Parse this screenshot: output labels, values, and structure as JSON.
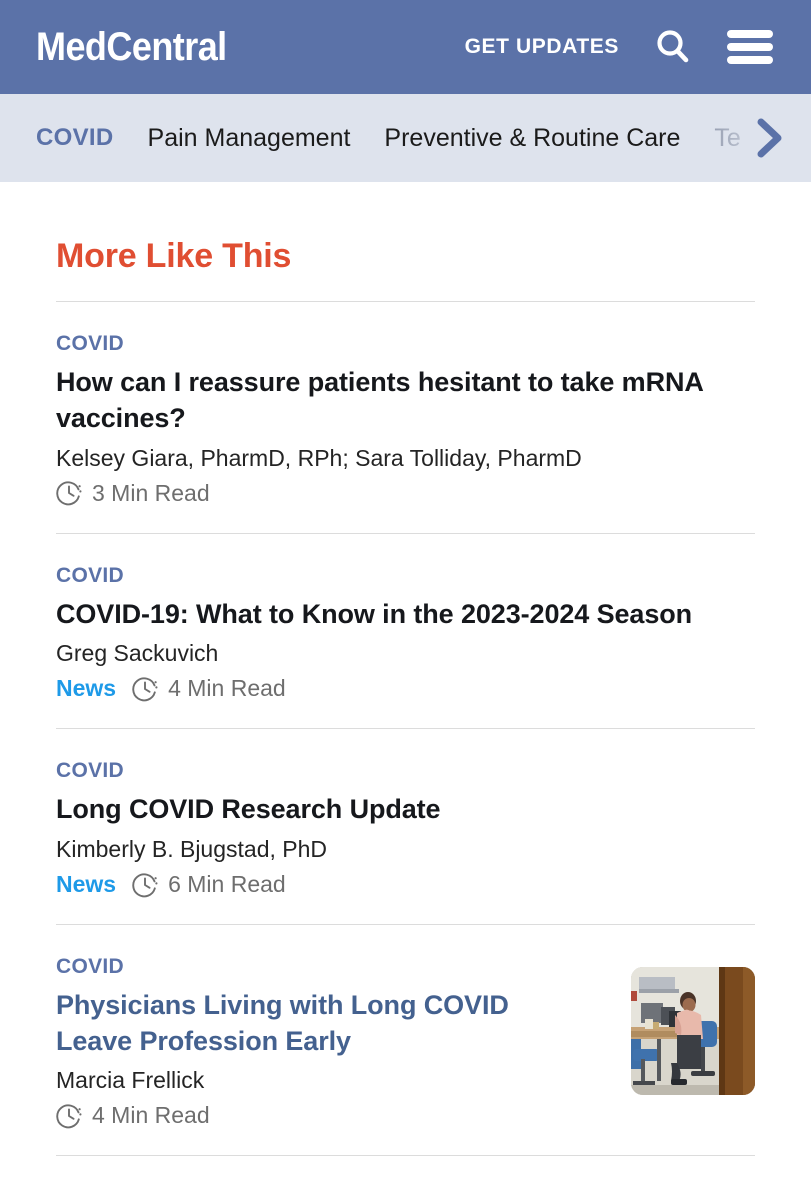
{
  "header": {
    "logo_text": "MedCentral",
    "get_updates_label": "GET UPDATES",
    "search_icon": "search-icon",
    "menu_icon": "hamburger-menu-icon",
    "background_color": "#5b72a8"
  },
  "navbar": {
    "background_color": "#dee3ed",
    "active_color": "#5b72a8",
    "items": [
      {
        "label": "COVID",
        "active": true
      },
      {
        "label": "Pain Management",
        "active": false
      },
      {
        "label": "Preventive & Routine Care",
        "active": false
      },
      {
        "label": "Te",
        "active": false,
        "truncated": true
      }
    ],
    "scroll_arrow_icon": "chevron-right-icon"
  },
  "main": {
    "section_title": "More Like This",
    "section_title_color": "#e04e32",
    "articles": [
      {
        "kicker": "COVID",
        "title": "How can I reassure patients hesitant to take mRNA vaccines?",
        "byline": "Kelsey Giara, PharmD, RPh; Sara Tolliday, PharmD",
        "tag": "",
        "read_time": "3 Min Read",
        "clock_icon": "clock-icon",
        "has_thumbnail": false,
        "title_is_link": false
      },
      {
        "kicker": "COVID",
        "title": "COVID-19: What to Know in the 2023-2024 Season",
        "byline": "Greg Sackuvich",
        "tag": "News",
        "read_time": "4 Min Read",
        "clock_icon": "clock-icon",
        "has_thumbnail": false,
        "title_is_link": false
      },
      {
        "kicker": "COVID",
        "title": "Long COVID Research Update",
        "byline": "Kimberly B. Bjugstad, PhD",
        "tag": "News",
        "read_time": "6 Min Read",
        "clock_icon": "clock-icon",
        "has_thumbnail": false,
        "title_is_link": false
      },
      {
        "kicker": "COVID",
        "title": "Physicians Living with Long COVID Leave Profession Early",
        "byline": "Marcia Frellick",
        "tag": "",
        "read_time": "4 Min Read",
        "clock_icon": "clock-icon",
        "has_thumbnail": true,
        "thumbnail_alt": "physician-sitting-at-desk-photo",
        "title_is_link": true
      }
    ]
  }
}
